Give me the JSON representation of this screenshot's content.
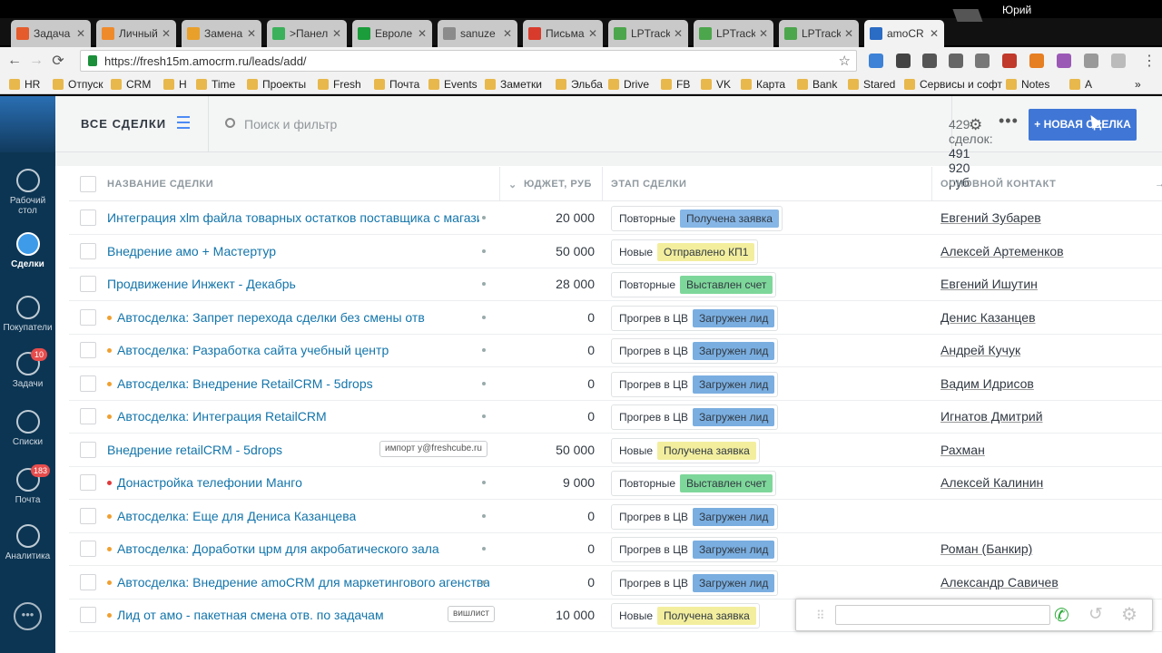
{
  "browser": {
    "tabs": [
      {
        "label": "Задача",
        "color": "#e55b2b"
      },
      {
        "label": "Личный",
        "color": "#ef8a2b"
      },
      {
        "label": "Замена",
        "color": "#e8a02b"
      },
      {
        "label": ">Панел",
        "color": "#3ab15a"
      },
      {
        "label": "Евроле",
        "color": "#1a9d3a"
      },
      {
        "label": "sanuze",
        "color": "#8b8b8b"
      },
      {
        "label": "Письма",
        "color": "#d83b2b"
      },
      {
        "label": "LPTrack",
        "color": "#4ca64c"
      },
      {
        "label": "LPTrack",
        "color": "#4ca64c"
      },
      {
        "label": "LPTrack",
        "color": "#4ca64c"
      },
      {
        "label": "amoCR",
        "color": "#2b6cc4"
      }
    ],
    "user": "Юрий",
    "url": "https://fresh15m.amocrm.ru/leads/add/",
    "bookmarks": [
      "HR",
      "Отпуск",
      "CRM",
      "H",
      "Time",
      "Проекты",
      "Fresh",
      "Почта",
      "Events",
      "Заметки",
      "Эльба",
      "Drive",
      "FB",
      "VK",
      "Карта",
      "Bank",
      "Stared",
      "Сервисы и софт",
      "Notes",
      "A"
    ]
  },
  "sidebar": {
    "items": [
      {
        "label": "Рабочий стол",
        "badge": ""
      },
      {
        "label": "Сделки",
        "badge": ""
      },
      {
        "label": "Покупатели",
        "badge": ""
      },
      {
        "label": "Задачи",
        "badge": "10"
      },
      {
        "label": "Списки",
        "badge": ""
      },
      {
        "label": "Почта",
        "badge": "183"
      },
      {
        "label": "Аналитика",
        "badge": ""
      }
    ]
  },
  "header": {
    "title": "ВСЕ СДЕЛКИ",
    "search_placeholder": "Поиск и фильтр",
    "summary_count": "429 сделок:",
    "summary_sum": "491 920 руб",
    "new_button": "+ НОВАЯ СДЕЛКА"
  },
  "table": {
    "columns": {
      "name": "НАЗВАНИЕ СДЕЛКИ",
      "budget": "ЮДЖЕТ, РУБ",
      "stage": "ЭТАП СДЕЛКИ",
      "contact": "ОСНОВНОЙ КОНТАКТ"
    },
    "rows": [
      {
        "name": "Интеграция xlm файла товарных остатков поставщика с магазином",
        "dot": "",
        "tag": "",
        "budget": "20 000",
        "stage_group": "Повторные",
        "stage": "Получена заявка",
        "stage_color": "#86b6e6",
        "contact": "Евгений Зубарев"
      },
      {
        "name": "Внедрение амо + Мастертур",
        "dot": "",
        "tag": "",
        "budget": "50 000",
        "stage_group": "Новые",
        "stage": "Отправлено КП1",
        "stage_color": "#f2ee9e",
        "contact": "Алексей Артеменков"
      },
      {
        "name": "Продвижение Инжект - Декабрь",
        "dot": "",
        "tag": "",
        "budget": "28 000",
        "stage_group": "Повторные",
        "stage": "Выставлен счет",
        "stage_color": "#7ed79a",
        "contact": "Евгений Ишутин"
      },
      {
        "name": "Автосделка: Запрет перехода сделки без смены отв",
        "dot": "#f0a030",
        "tag": "",
        "budget": "0",
        "stage_group": "Прогрев в ЦВ",
        "stage": "Загружен лид",
        "stage_color": "#7aaee0",
        "contact": "Денис Казанцев"
      },
      {
        "name": "Автосделка: Разработка сайта учебный центр",
        "dot": "#f0a030",
        "tag": "",
        "budget": "0",
        "stage_group": "Прогрев в ЦВ",
        "stage": "Загружен лид",
        "stage_color": "#7aaee0",
        "contact": "Андрей Кучук"
      },
      {
        "name": "Автосделка: Внедрение RetailCRM - 5drops",
        "dot": "#f0a030",
        "tag": "",
        "budget": "0",
        "stage_group": "Прогрев в ЦВ",
        "stage": "Загружен лид",
        "stage_color": "#7aaee0",
        "contact": "Вадим Идрисов"
      },
      {
        "name": "Автосделка: Интеграция RetailCRM",
        "dot": "#f0a030",
        "tag": "",
        "budget": "0",
        "stage_group": "Прогрев в ЦВ",
        "stage": "Загружен лид",
        "stage_color": "#7aaee0",
        "contact": "Игнатов Дмитрий"
      },
      {
        "name": "Внедрение retailCRM - 5drops",
        "dot": "",
        "tag": "импорт y@freshcube.ru",
        "budget": "50 000",
        "stage_group": "Новые",
        "stage": "Получена заявка",
        "stage_color": "#f2ee9e",
        "contact": "Рахман"
      },
      {
        "name": "Донастройка телефонии Манго",
        "dot": "#e03a3a",
        "tag": "",
        "budget": "9 000",
        "stage_group": "Повторные",
        "stage": "Выставлен счет",
        "stage_color": "#7ed79a",
        "contact": "Алексей Калинин"
      },
      {
        "name": "Автосделка: Еще для Дениса Казанцева",
        "dot": "#f0a030",
        "tag": "",
        "budget": "0",
        "stage_group": "Прогрев в ЦВ",
        "stage": "Загружен лид",
        "stage_color": "#7aaee0",
        "contact": ""
      },
      {
        "name": "Автосделка: Доработки црм для акробатического зала",
        "dot": "#f0a030",
        "tag": "",
        "budget": "0",
        "stage_group": "Прогрев в ЦВ",
        "stage": "Загружен лид",
        "stage_color": "#7aaee0",
        "contact": "Роман (Банкир)"
      },
      {
        "name": "Автосделка: Внедрение amoCRM для маркетингового агенства",
        "dot": "#f0a030",
        "tag": "",
        "budget": "0",
        "stage_group": "Прогрев в ЦВ",
        "stage": "Загружен лид",
        "stage_color": "#7aaee0",
        "contact": "Александр Савичев"
      },
      {
        "name": "Лид от амо - пакетная смена отв. по задачам",
        "dot": "#f0a030",
        "tag": "вишлист",
        "budget": "10 000",
        "stage_group": "Новые",
        "stage": "Получена заявка",
        "stage_color": "#f2ee9e",
        "contact": ""
      }
    ]
  }
}
